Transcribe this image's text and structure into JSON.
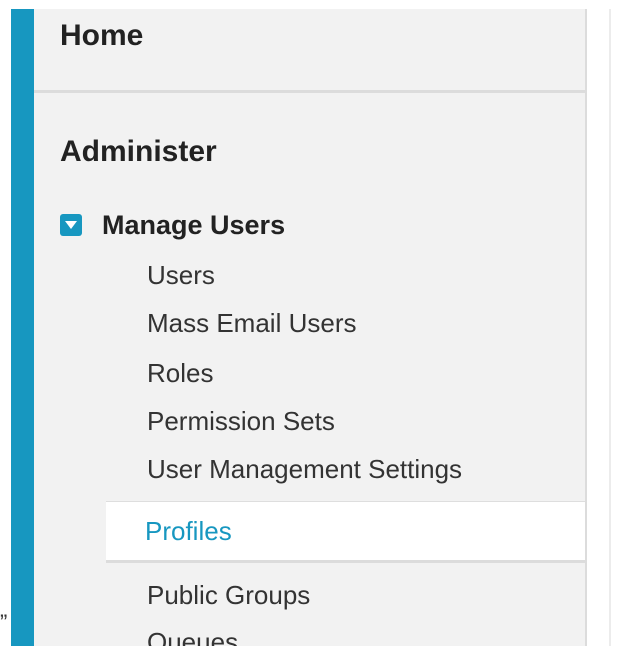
{
  "nav": {
    "home_label": "Home",
    "section_title": "Administer",
    "group": {
      "label": "Manage Users",
      "expanded": true,
      "toggle_icon": "collapse-triangle-icon"
    },
    "items": [
      {
        "label": "Users"
      },
      {
        "label": "Mass Email Users"
      },
      {
        "label": "Roles"
      },
      {
        "label": "Permission Sets"
      },
      {
        "label": "User Management Settings"
      },
      {
        "label": "Profiles",
        "selected": true
      },
      {
        "label": "Public Groups"
      },
      {
        "label": "Queues"
      }
    ]
  },
  "stray_mark": "”",
  "colors": {
    "accent": "#1797c0",
    "sidebar_bg": "#f2f2f2",
    "selected_bg": "#ffffff",
    "text": "#333333"
  }
}
